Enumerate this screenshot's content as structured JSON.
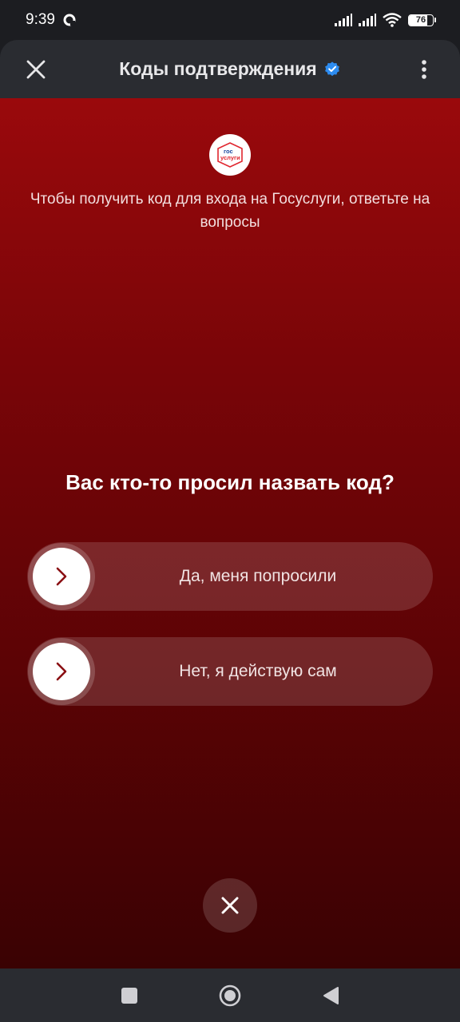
{
  "status_bar": {
    "time": "9:39",
    "battery_level": 76,
    "battery_text": "76"
  },
  "header": {
    "title": "Коды подтверждения",
    "close_icon": "close-icon",
    "verified_icon": "verified-badge-icon",
    "menu_icon": "more-vertical-icon"
  },
  "main": {
    "logo_text_top": "гос",
    "logo_text_bottom": "услуги",
    "intro_text": "Чтобы получить код для входа на Госуслуги, ответьте на вопросы",
    "question": "Вас кто-то просил назвать код?",
    "options": [
      {
        "label": "Да, меня попросили",
        "icon": "chevron-right-icon"
      },
      {
        "label": "Нет, я действую сам",
        "icon": "chevron-right-icon"
      }
    ],
    "dismiss_icon": "close-icon"
  },
  "nav_bar": {
    "recent_icon": "square-icon",
    "home_icon": "circle-icon",
    "back_icon": "triangle-back-icon"
  },
  "colors": {
    "accent_red_top": "#9a090c",
    "accent_red_bottom": "#3a0203",
    "header_bg": "#2a2c31",
    "verified_blue": "#2d8cf0",
    "chevron": "#8a0e12"
  }
}
